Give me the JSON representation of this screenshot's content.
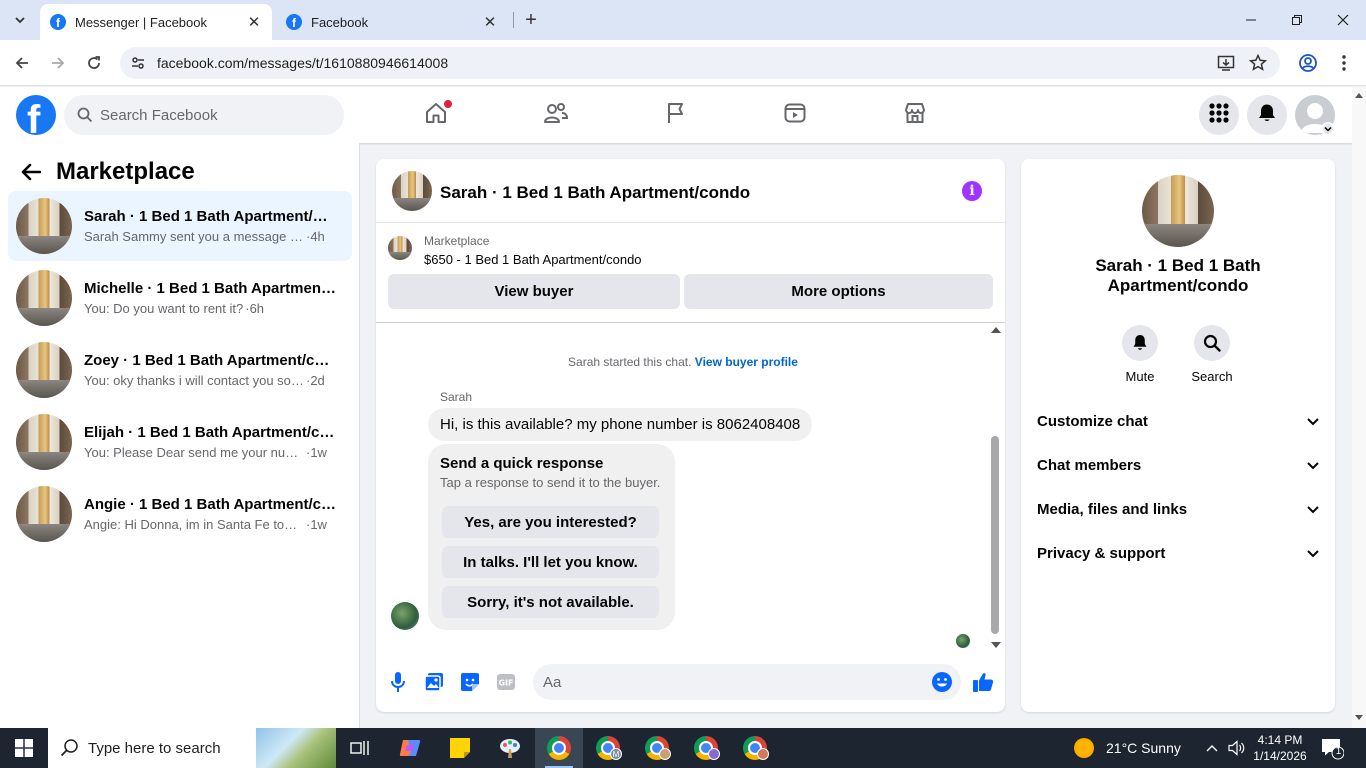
{
  "browser": {
    "tabs": [
      {
        "label": "Messenger | Facebook",
        "active": true
      },
      {
        "label": "Facebook",
        "active": false
      }
    ],
    "url": "facebook.com/messages/t/1610880946614008"
  },
  "fb_header": {
    "search_placeholder": "Search Facebook",
    "brand_color": "#1877f2"
  },
  "left_panel": {
    "title": "Marketplace",
    "conversations": [
      {
        "name": "Sarah · 1 Bed 1 Bath Apartment/condo",
        "snippet": "Sarah Sammy sent you a message about...",
        "time": "·4h",
        "selected": true
      },
      {
        "name": "Michelle · 1 Bed 1 Bath Apartment/condo",
        "snippet": "You: Do you want to rent it?",
        "time": "·6h",
        "selected": false
      },
      {
        "name": "Zoey · 1 Bed 1 Bath Apartment/condo",
        "snippet": "You: oky thanks i will contact you soon",
        "time": "·2d",
        "selected": false
      },
      {
        "name": "Elijah · 1 Bed 1 Bath Apartment/condo",
        "snippet": "You: Please Dear send me your number",
        "time": "·1w",
        "selected": false
      },
      {
        "name": "Angie · 1 Bed 1 Bath Apartment/condo",
        "snippet": "Angie: Hi Donna, im in Santa Fe today...",
        "time": "·1w",
        "selected": false
      }
    ]
  },
  "chat": {
    "title": "Sarah · 1 Bed 1 Bath Apartment/condo",
    "marketplace_label": "Marketplace",
    "listing": "$650 - 1 Bed 1 Bath Apartment/condo",
    "view_buyer": "View buyer",
    "more_options": "More options",
    "started_text": "Sarah started this chat.",
    "view_profile": "View buyer profile",
    "sender": "Sarah",
    "message": "Hi, is this available? my phone number is 8062408408",
    "quick_title": "Send a quick response",
    "quick_sub": "Tap a response to send it to the buyer.",
    "quick_responses": [
      "Yes, are you interested?",
      "In talks. I'll let you know.",
      "Sorry, it's not available."
    ],
    "input_placeholder": "Aa"
  },
  "right_panel": {
    "name": "Sarah · 1 Bed 1 Bath Apartment/condo",
    "mute": "Mute",
    "search": "Search",
    "sections": [
      "Customize chat",
      "Chat members",
      "Media, files and links",
      "Privacy & support"
    ]
  },
  "taskbar": {
    "search_placeholder": "Type here to search",
    "weather": "21°C  Sunny",
    "time": "4:14 PM",
    "date": "1/14/2026",
    "notif_count": "1"
  }
}
